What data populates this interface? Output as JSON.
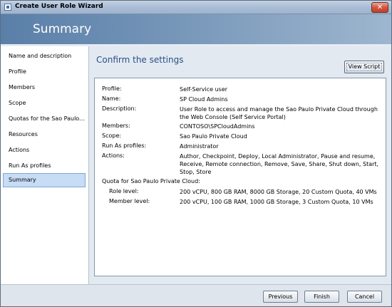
{
  "window": {
    "title": "Create User Role Wizard",
    "close_glyph": "✕"
  },
  "header": {
    "title": "Summary"
  },
  "nav": {
    "items": [
      {
        "label": "Name and description"
      },
      {
        "label": "Profile"
      },
      {
        "label": "Members"
      },
      {
        "label": "Scope"
      },
      {
        "label": "Quotas for the Sao Paulo..."
      },
      {
        "label": "Resources"
      },
      {
        "label": "Actions"
      },
      {
        "label": "Run As profiles"
      },
      {
        "label": "Summary",
        "selected": true
      }
    ]
  },
  "main": {
    "title": "Confirm the settings",
    "view_script_label": "View Script",
    "rows": [
      {
        "label": "Profile:",
        "value": "Self-Service user"
      },
      {
        "label": "Name:",
        "value": "SP Cloud Admins"
      },
      {
        "label": "Description:",
        "value": "User Role to access and manage the Sao Paulo Private Cloud through the Web Console (Self Service Portal)"
      },
      {
        "label": "Members:",
        "value": "CONTOSO\\SPCloudAdmins"
      },
      {
        "label": "Scope:",
        "value": "Sao Paulo Private Cloud"
      },
      {
        "label": "Run As profiles:",
        "value": "Administrator"
      },
      {
        "label": "Actions:",
        "value": "Author, Checkpoint, Deploy, Local Administrator, Pause and resume, Receive, Remote connection, Remove, Save, Share, Shut down, Start, Stop, Store"
      },
      {
        "label": "Quota for Sao Paulo Private Cloud:",
        "value": ""
      },
      {
        "label": "Role level:",
        "value": "200 vCPU, 800 GB RAM, 8000 GB Storage, 20 Custom Quota, 40 VMs"
      },
      {
        "label": "Member level:",
        "value": "200 vCPU, 100 GB RAM, 1000 GB Storage, 3 Custom Quota, 10 VMs"
      }
    ]
  },
  "footer": {
    "previous_label": "Previous",
    "finish_label": "Finish",
    "cancel_label": "Cancel"
  },
  "colors": {
    "header_band": "#6c8eb3",
    "selected_nav": "#c7dcf5",
    "content_title": "#2a4f86"
  }
}
